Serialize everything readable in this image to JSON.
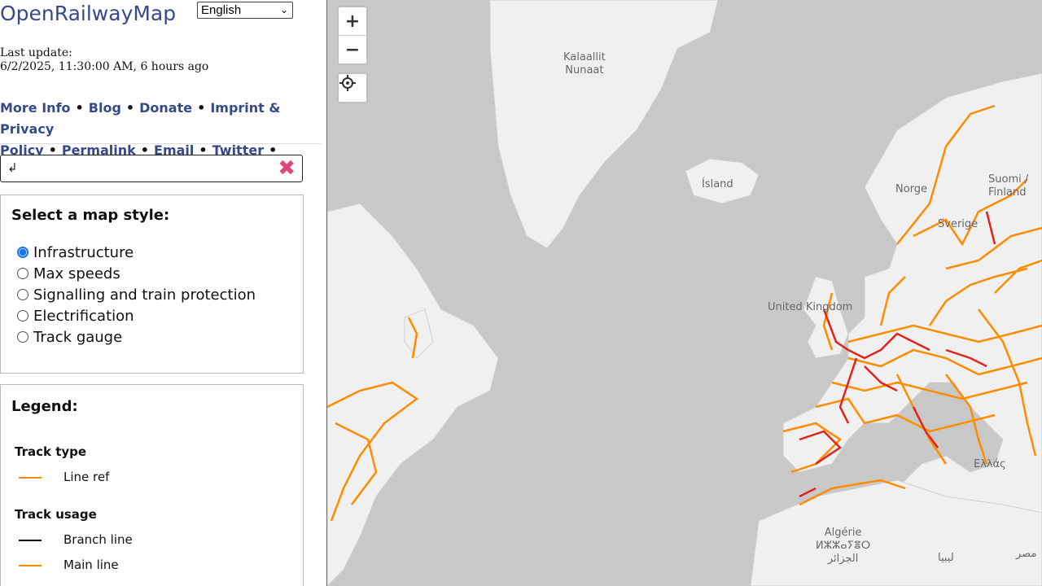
{
  "sidebar": {
    "title": "OpenRailwayMap",
    "language": "English",
    "last_update_label": "Last update:",
    "last_update_value": "6/2/2025, 11:30:00 AM, 6 hours ago",
    "links": [
      "More Info",
      "Blog",
      "Donate",
      "Imprint & Privacy Policy",
      "Permalink",
      "Email",
      "Twitter"
    ],
    "search": {
      "value": "↲",
      "clear_icon": "close-icon"
    },
    "style_panel": {
      "heading": "Select a map style:",
      "options": [
        "Infrastructure",
        "Max speeds",
        "Signalling and train protection",
        "Electrification",
        "Track gauge"
      ],
      "selected": "Infrastructure"
    },
    "legend": {
      "heading": "Legend:",
      "track_type_title": "Track type",
      "track_type_items": [
        {
          "label": "Line ref",
          "color": "#ff8c00"
        }
      ],
      "track_usage_title": "Track usage",
      "track_usage_items": [
        {
          "label": "Branch line",
          "color": "#000000"
        },
        {
          "label": "Main line",
          "color": "#ff8c00"
        }
      ]
    }
  },
  "map": {
    "zoom_in": "+",
    "zoom_out": "−",
    "locate_icon": "crosshair-icon",
    "labels": {
      "greenland_1": "Kalaallit",
      "greenland_2": "Nunaat",
      "iceland": "Ísland",
      "norway": "Norge",
      "sweden": "Sverige",
      "finland_1": "Suomi /",
      "finland_2": "Finland",
      "uk": "United Kingdom",
      "greece": "Ελλάς",
      "algeria_1": "Algérie",
      "algeria_2": "ⵍⵣⵣⴰⵢⴻⵔ",
      "algeria_3": "الجزائر",
      "libya": "ليبيا",
      "egypt": "مصر"
    },
    "colors": {
      "water": "#c8c8c8",
      "land": "#f0f0f0",
      "main_line": "#ff8c00",
      "high_speed": "#e0241a"
    }
  }
}
